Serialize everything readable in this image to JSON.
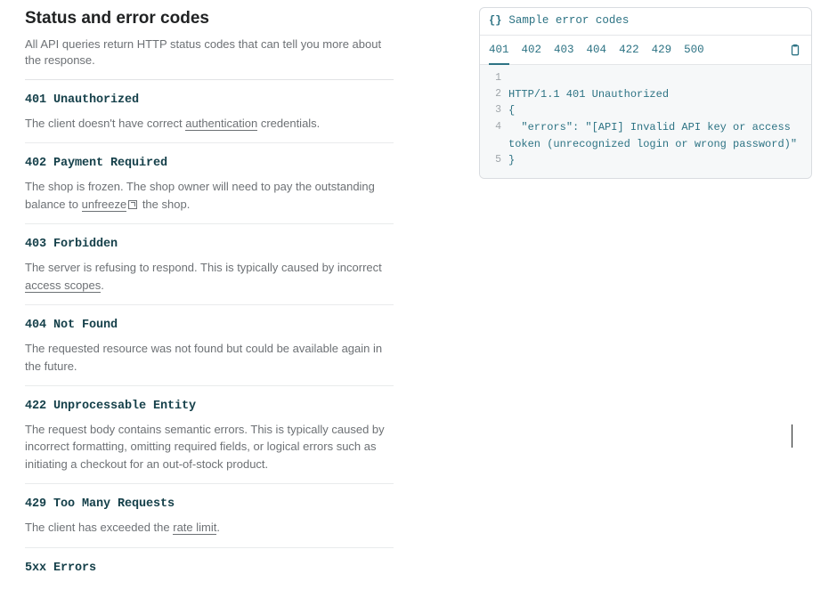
{
  "page": {
    "title": "Status and error codes",
    "intro": "All API queries return HTTP status codes that can tell you more about the response."
  },
  "errors": [
    {
      "key": "401",
      "heading": "401 Unauthorized",
      "pre": "The client doesn't have correct ",
      "link": "authentication",
      "ext": false,
      "post": " credentials."
    },
    {
      "key": "402",
      "heading": "402 Payment Required",
      "pre": "The shop is frozen. The shop owner will need to pay the outstanding balance to ",
      "link": "unfreeze",
      "ext": true,
      "post": " the shop."
    },
    {
      "key": "403",
      "heading": "403 Forbidden",
      "pre": "The server is refusing to respond. This is typically caused by incorrect ",
      "link": "access scopes",
      "ext": false,
      "post": "."
    },
    {
      "key": "404",
      "heading": "404 Not Found",
      "body": "The requested resource was not found but could be available again in the future."
    },
    {
      "key": "422",
      "heading": "422 Unprocessable Entity",
      "body": "The request body contains semantic errors. This is typically caused by incorrect formatting, omitting required fields, or logical errors such as initiating a checkout for an out-of-stock product."
    },
    {
      "key": "429",
      "heading": "429 Too Many Requests",
      "pre": "The client has exceeded the ",
      "link": "rate limit",
      "ext": false,
      "post": "."
    },
    {
      "key": "5xx",
      "heading": "5xx Errors",
      "body": ""
    }
  ],
  "code_panel": {
    "title": "Sample error codes",
    "tabs": [
      "401",
      "402",
      "403",
      "404",
      "422",
      "429",
      "500"
    ],
    "active_tab": "401",
    "lines": [
      {
        "no": "1",
        "text": ""
      },
      {
        "no": "2",
        "text": "HTTP/1.1 401 Unauthorized"
      },
      {
        "no": "3",
        "text": "{"
      },
      {
        "no": "4",
        "text": "  \"errors\": \"[API] Invalid API key or access token (unrecognized login or wrong password)\""
      },
      {
        "no": "5",
        "text": "}"
      }
    ]
  }
}
